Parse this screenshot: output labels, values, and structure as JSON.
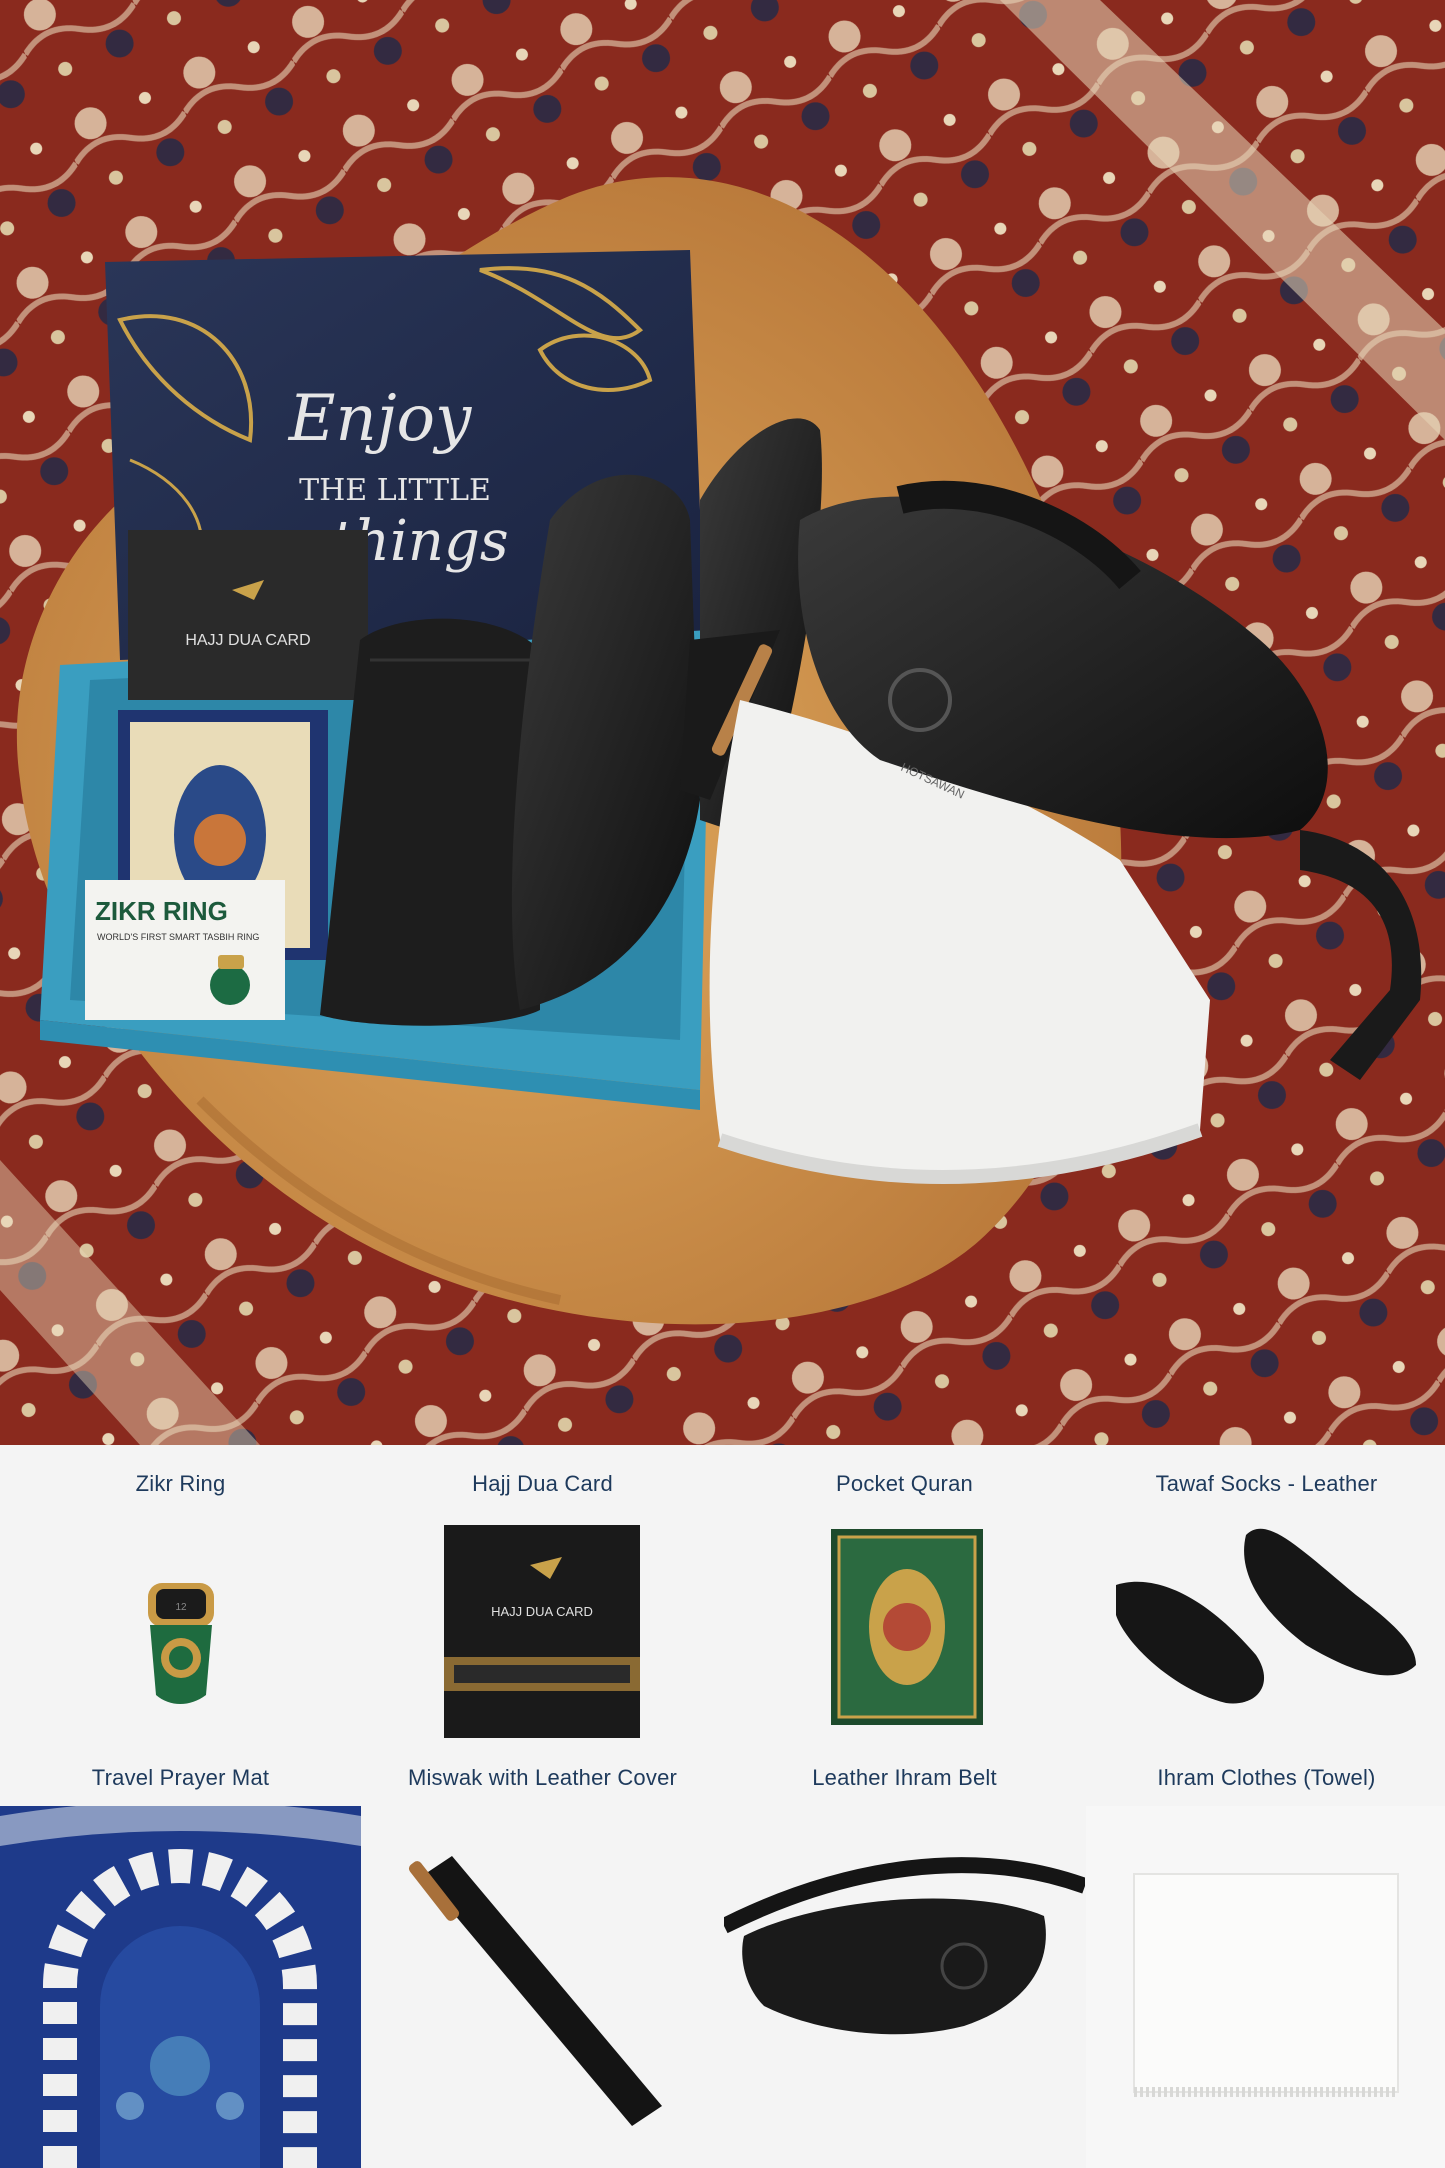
{
  "hero": {
    "box_lid_text_1": "Enjoy",
    "box_lid_text_2": "THE LITTLE",
    "box_lid_text_3": "things",
    "dua_card_label": "HAJJ DUA CARD",
    "zikr_box_title": "ZIKR RING",
    "zikr_box_subtitle": "WORLD'S FIRST SMART TASBIH RING",
    "belt_brand": "HOTSAWAN"
  },
  "products": [
    {
      "name": "Zikr Ring"
    },
    {
      "name": "Hajj Dua Card",
      "card_label": "HAJJ DUA CARD"
    },
    {
      "name": "Pocket Quran"
    },
    {
      "name": "Tawaf Socks - Leather"
    },
    {
      "name": "Travel Prayer Mat"
    },
    {
      "name": "Miswak with Leather Cover"
    },
    {
      "name": "Leather Ihram Belt"
    },
    {
      "name": "Ihram Clothes (Towel)"
    }
  ],
  "colors": {
    "caption": "#1e3a5c",
    "rug_red": "#8a2a1e",
    "box_navy": "#1f2a48",
    "box_teal": "#3a9ec0",
    "gold": "#c9a24a"
  }
}
